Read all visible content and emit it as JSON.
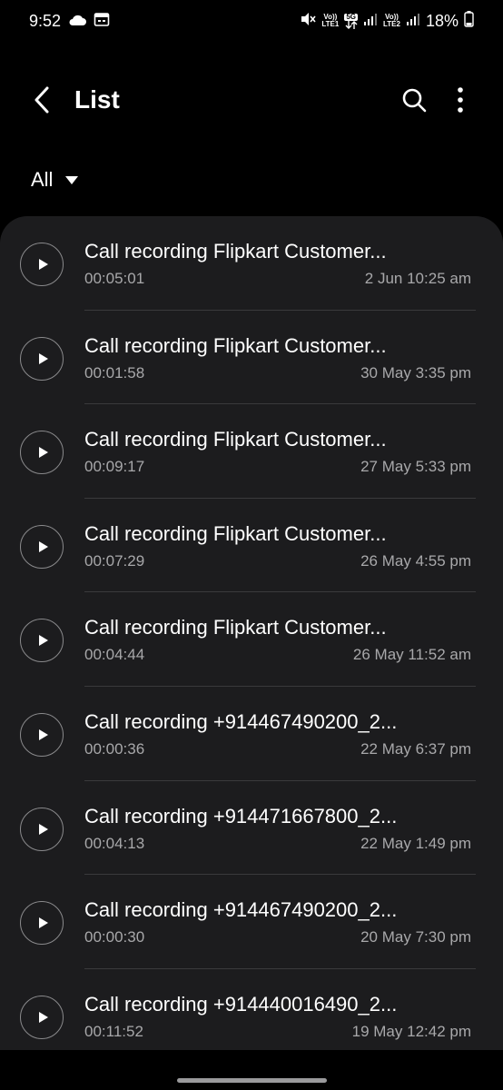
{
  "status": {
    "time": "9:52",
    "net1": "LTE1",
    "net2": "LTE2",
    "net5g": "5G",
    "volte": "Vo))",
    "battery": "18%"
  },
  "header": {
    "title": "List"
  },
  "filter": {
    "label": "All"
  },
  "items": [
    {
      "title": "Call recording Flipkart Customer...",
      "duration": "00:05:01",
      "date": "2 Jun 10:25 am"
    },
    {
      "title": "Call recording Flipkart Customer...",
      "duration": "00:01:58",
      "date": "30 May 3:35 pm"
    },
    {
      "title": "Call recording Flipkart Customer...",
      "duration": "00:09:17",
      "date": "27 May 5:33 pm"
    },
    {
      "title": "Call recording Flipkart Customer...",
      "duration": "00:07:29",
      "date": "26 May 4:55 pm"
    },
    {
      "title": "Call recording Flipkart Customer...",
      "duration": "00:04:44",
      "date": "26 May 11:52 am"
    },
    {
      "title": "Call recording +914467490200_2...",
      "duration": "00:00:36",
      "date": "22 May 6:37 pm"
    },
    {
      "title": "Call recording +914471667800_2...",
      "duration": "00:04:13",
      "date": "22 May 1:49 pm"
    },
    {
      "title": "Call recording +914467490200_2...",
      "duration": "00:00:30",
      "date": "20 May 7:30 pm"
    },
    {
      "title": "Call recording +914440016490_2...",
      "duration": "00:11:52",
      "date": "19 May 12:42 pm"
    }
  ]
}
